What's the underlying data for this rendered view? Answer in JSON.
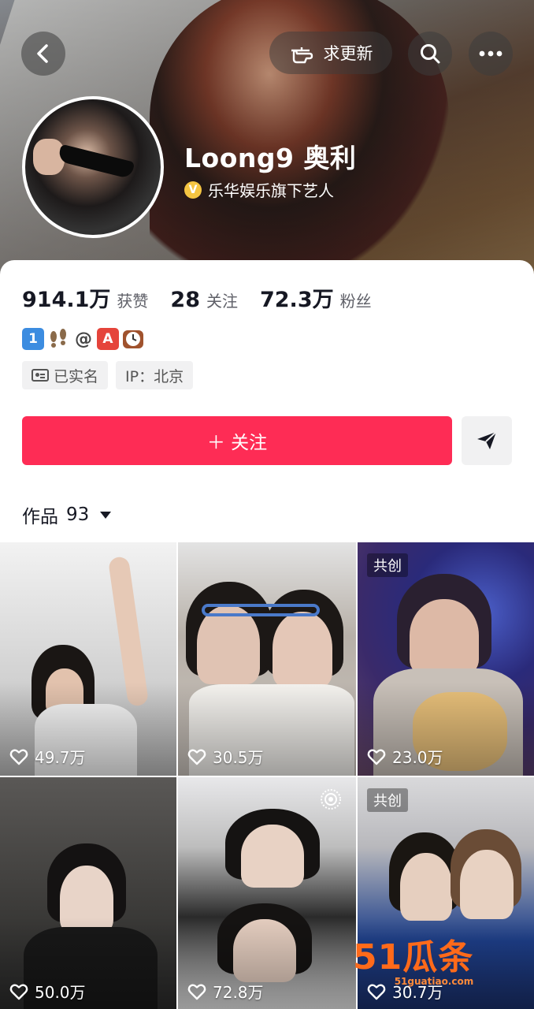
{
  "header": {
    "request_update_label": "求更新",
    "nickname": "Loong9 奥利",
    "verify_badge": "V",
    "verify_text": "乐华娱乐旗下艺人"
  },
  "stats": [
    {
      "num": "914.1万",
      "label": "获赞"
    },
    {
      "num": "28",
      "label": "关注"
    },
    {
      "num": "72.3万",
      "label": "粉丝"
    }
  ],
  "bio": {
    "emoji_one": "1",
    "emoji_at": "@",
    "emoji_a": "A"
  },
  "tags": {
    "real_name": "已实名",
    "ip": "IP：北京"
  },
  "actions": {
    "follow_label": "＋ 关注"
  },
  "works": {
    "label": "作品",
    "count": "93"
  },
  "videos": [
    {
      "likes": "49.7万",
      "badge": ""
    },
    {
      "likes": "30.5万",
      "badge": ""
    },
    {
      "likes": "23.0万",
      "badge": "共创"
    },
    {
      "likes": "50.0万",
      "badge": ""
    },
    {
      "likes": "72.8万",
      "badge": ""
    },
    {
      "likes": "30.7万",
      "badge": "共创"
    }
  ],
  "watermark": {
    "text": "51瓜条",
    "url": "51guatiao.com"
  },
  "colors": {
    "accent": "#fe2c55",
    "verify": "#f5c542"
  }
}
